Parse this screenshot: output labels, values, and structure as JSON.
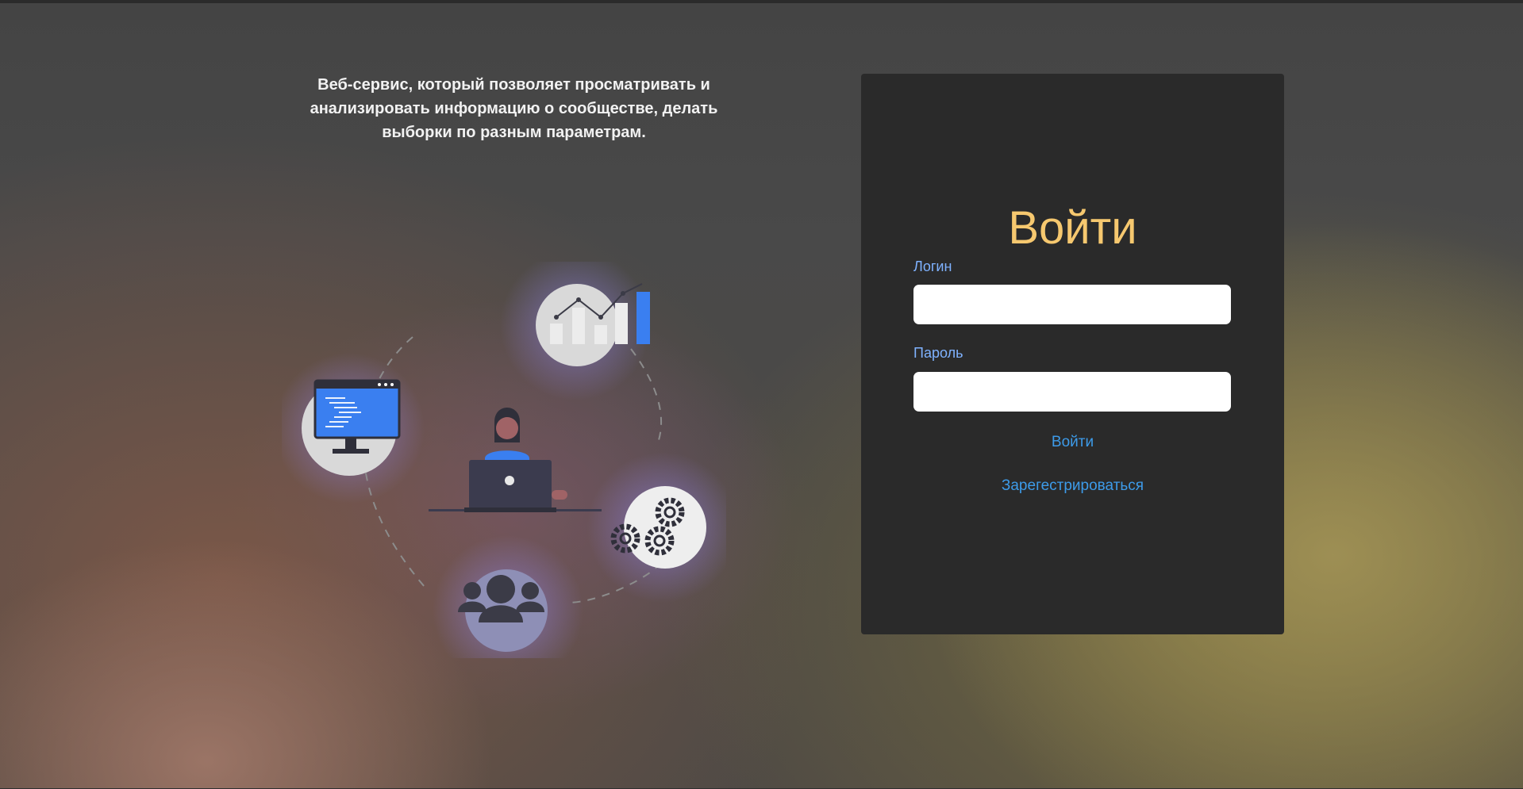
{
  "intro": {
    "text": "Веб-сервис, который позволяет просматривать и анализировать информацию о сообществе, делать выборки по разным параметрам."
  },
  "login_form": {
    "title": "Войти",
    "login_label": "Логин",
    "login_value": "",
    "password_label": "Пароль",
    "password_value": "",
    "submit_label": "Войти",
    "register_label": "Зарегестрироваться"
  },
  "illustration": {
    "icons": [
      "computer-monitor-icon",
      "analytics-chart-icon",
      "person-with-laptop-icon",
      "gears-icon",
      "team-group-icon"
    ]
  },
  "colors": {
    "title": "#f6c86f",
    "label": "#7fb2ff",
    "link": "#3d9be9",
    "card": "#2a2a2a",
    "accent_blue": "#3a7ff0"
  }
}
